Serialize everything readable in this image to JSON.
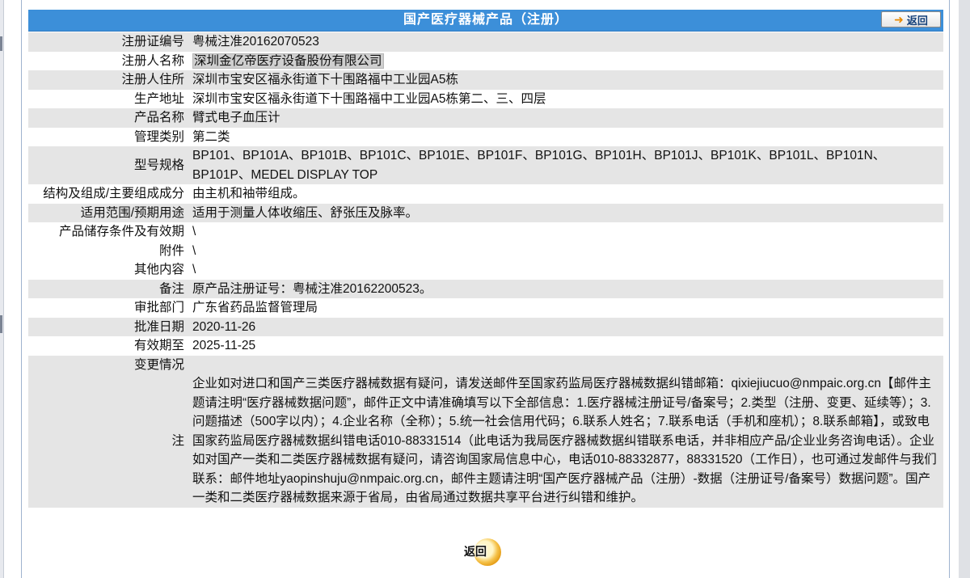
{
  "header": {
    "title": "国产医疗器械产品（注册）",
    "back_label": "返回"
  },
  "rows": [
    {
      "label": "注册证编号",
      "value": "粤械注准20162070523"
    },
    {
      "label": "注册人名称",
      "value": "深圳金亿帝医疗设备股份有限公司"
    },
    {
      "label": "注册人住所",
      "value": "深圳市宝安区福永街道下十围路福中工业园A5栋"
    },
    {
      "label": "生产地址",
      "value": "深圳市宝安区福永街道下十围路福中工业园A5栋第二、三、四层"
    },
    {
      "label": "产品名称",
      "value": "臂式电子血压计"
    },
    {
      "label": "管理类别",
      "value": "第二类"
    },
    {
      "label": "型号规格",
      "value": "BP101、BP101A、BP101B、BP101C、BP101E、BP101F、BP101G、BP101H、BP101J、BP101K、BP101L、BP101N、BP101P、MEDEL DISPLAY TOP"
    },
    {
      "label": "结构及组成/主要组成成分",
      "value": "由主机和袖带组成。"
    },
    {
      "label": "适用范围/预期用途",
      "value": "适用于测量人体收缩压、舒张压及脉率。"
    },
    {
      "label": "产品储存条件及有效期",
      "value": "\\"
    },
    {
      "label": "附件",
      "value": "\\"
    },
    {
      "label": "其他内容",
      "value": "\\"
    },
    {
      "label": "备注",
      "value": "原产品注册证号：粤械注准20162200523。"
    },
    {
      "label": "审批部门",
      "value": "广东省药品监督管理局"
    },
    {
      "label": "批准日期",
      "value": "2020-11-26"
    },
    {
      "label": "有效期至",
      "value": "2025-11-25"
    },
    {
      "label": "变更情况",
      "value": ""
    }
  ],
  "note": {
    "label": "注",
    "text": "企业如对进口和国产三类医疗器械数据有疑问，请发送邮件至国家药监局医疗器械数据纠错邮箱：qixiejiucuo@nmpaic.org.cn【邮件主题请注明“医疗器械数据问题”，邮件正文中请准确填写以下全部信息：1.医疗器械注册证号/备案号；2.类型（注册、变更、延续等）；3.问题描述（500字以内）；4.企业名称（全称）；5.统一社会信用代码；6.联系人姓名；7.联系电话（手机和座机）；8.联系邮箱】，或致电国家药监局医疗器械数据纠错电话010-88331514（此电话为我局医疗器械数据纠错联系电话，并非相应产品/企业业务咨询电话）。企业如对国产一类和二类医疗器械数据有疑问，请咨询国家局信息中心，电话010-88332877，88331520（工作日），也可通过发邮件与我们联系：邮件地址yaopinshuju@nmpaic.org.cn，邮件主题请注明“国产医疗器械产品（注册）-数据（注册证号/备案号）数据问题”。国产一类和二类医疗器械数据来源于省局，由省局通过数据共享平台进行纠错和维护。"
  },
  "footer": {
    "back_label": "返回"
  }
}
